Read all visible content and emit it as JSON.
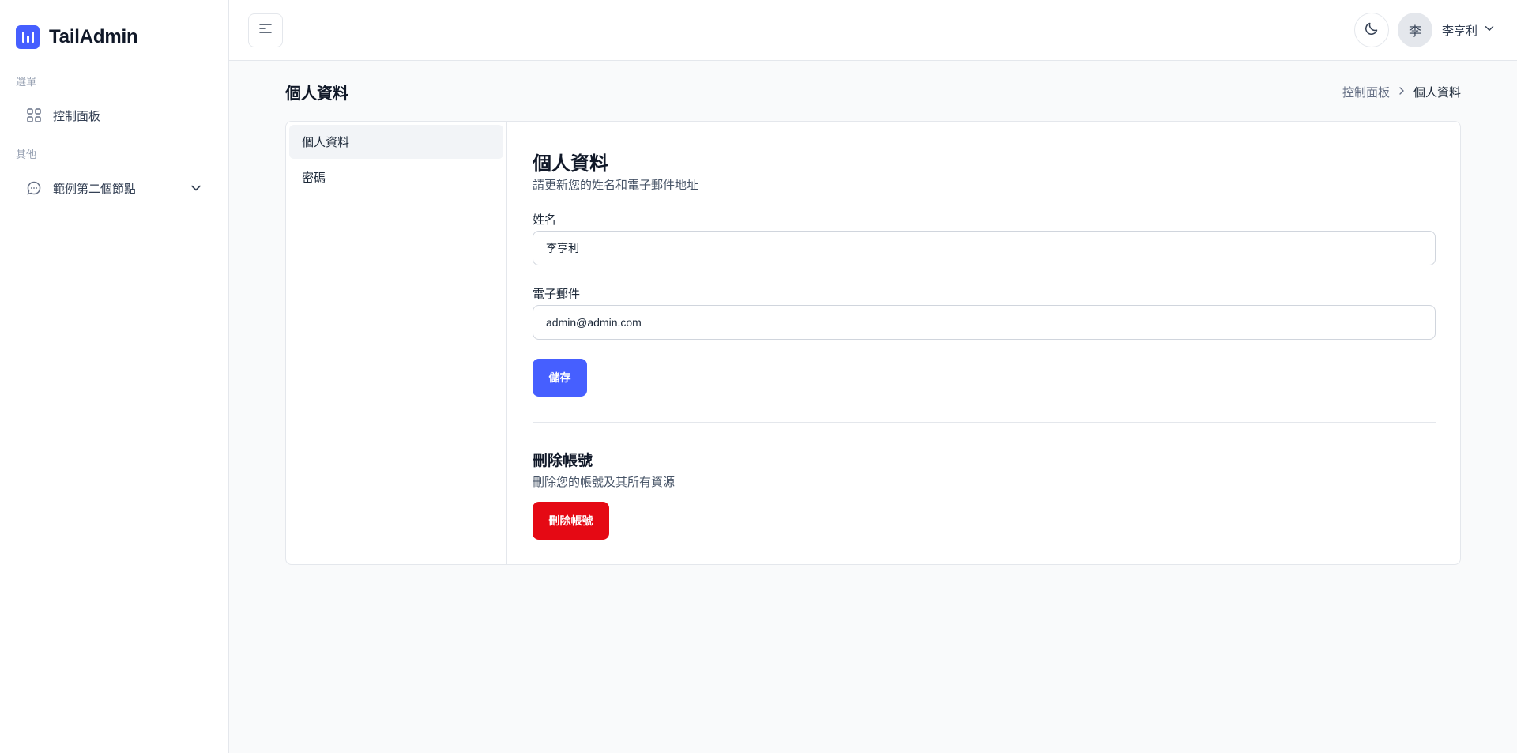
{
  "app": {
    "name": "TailAdmin",
    "accent_color": "#465fff",
    "danger_color": "#e50914"
  },
  "sidebar": {
    "groups": [
      {
        "label": "選單",
        "items": [
          {
            "label": "控制面板",
            "icon": "grid-icon"
          }
        ]
      },
      {
        "label": "其他",
        "items": [
          {
            "label": "範例第二個節點",
            "icon": "chat-bubble-icon",
            "expandable": true
          }
        ]
      }
    ]
  },
  "header": {
    "menu_toggle_icon": "menu-lines-icon",
    "theme_toggle_icon": "moon-icon",
    "user": {
      "avatar_initial": "李",
      "name": "李亨利"
    }
  },
  "page": {
    "title": "個人資料",
    "breadcrumb": {
      "parent": "控制面板",
      "current": "個人資料"
    }
  },
  "settings_nav": {
    "items": [
      {
        "label": "個人資料",
        "active": true
      },
      {
        "label": "密碼",
        "active": false
      }
    ]
  },
  "profile": {
    "title": "個人資料",
    "description": "請更新您的姓名和電子郵件地址",
    "name_label": "姓名",
    "name_value": "李亨利",
    "email_label": "電子郵件",
    "email_value": "admin@admin.com",
    "save_label": "儲存"
  },
  "delete_account": {
    "title": "刪除帳號",
    "description": "刪除您的帳號及其所有資源",
    "button_label": "刪除帳號"
  }
}
